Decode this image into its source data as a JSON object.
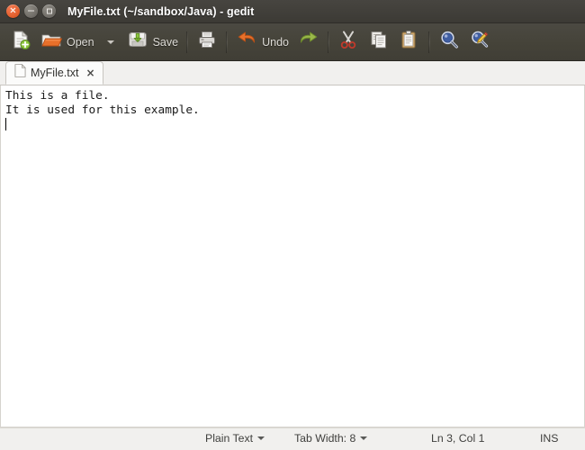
{
  "window": {
    "title": "MyFile.txt (~/sandbox/Java) - gedit",
    "controls": [
      {
        "name": "close-button",
        "glyph": "×"
      },
      {
        "name": "minimize-button",
        "glyph": "−"
      },
      {
        "name": "maximize-button",
        "glyph": "□"
      }
    ],
    "colors": {
      "titlebar": "#3c3a35",
      "toolbar": "#454339",
      "close_button": "#e4602d",
      "accent_orange": "#e4602d",
      "editor_background": "#ffffff",
      "statusbar": "#f1f0ee"
    }
  },
  "toolbar": {
    "new_label": "",
    "open_label": "Open",
    "open_dropdown": "▾",
    "save_label": "Save",
    "print_label": "",
    "undo_label": "Undo",
    "redo_label": "",
    "cut_label": "",
    "copy_label": "",
    "paste_label": "",
    "find_label": "",
    "replace_label": "",
    "icons": [
      "new-document-icon",
      "open-folder-icon",
      "save-disk-icon",
      "print-icon",
      "undo-arrow-icon",
      "redo-arrow-icon",
      "cut-scissors-icon",
      "copy-icon",
      "paste-clipboard-icon",
      "find-magnifier-icon",
      "replace-magnifier-pencil-icon"
    ]
  },
  "tabs": [
    {
      "label": "MyFile.txt",
      "close": "×",
      "active": true
    }
  ],
  "editor": {
    "lines": [
      "This is a file.",
      "It is used for this example."
    ],
    "cursor_line": 3,
    "cursor_column": 1
  },
  "statusbar": {
    "language": "Plain Text",
    "language_arrow": "▾",
    "tab_width": "Tab Width: 8",
    "tab_width_arrow": "▾",
    "position": "Ln 3, Col 1",
    "insert_mode": "INS"
  }
}
